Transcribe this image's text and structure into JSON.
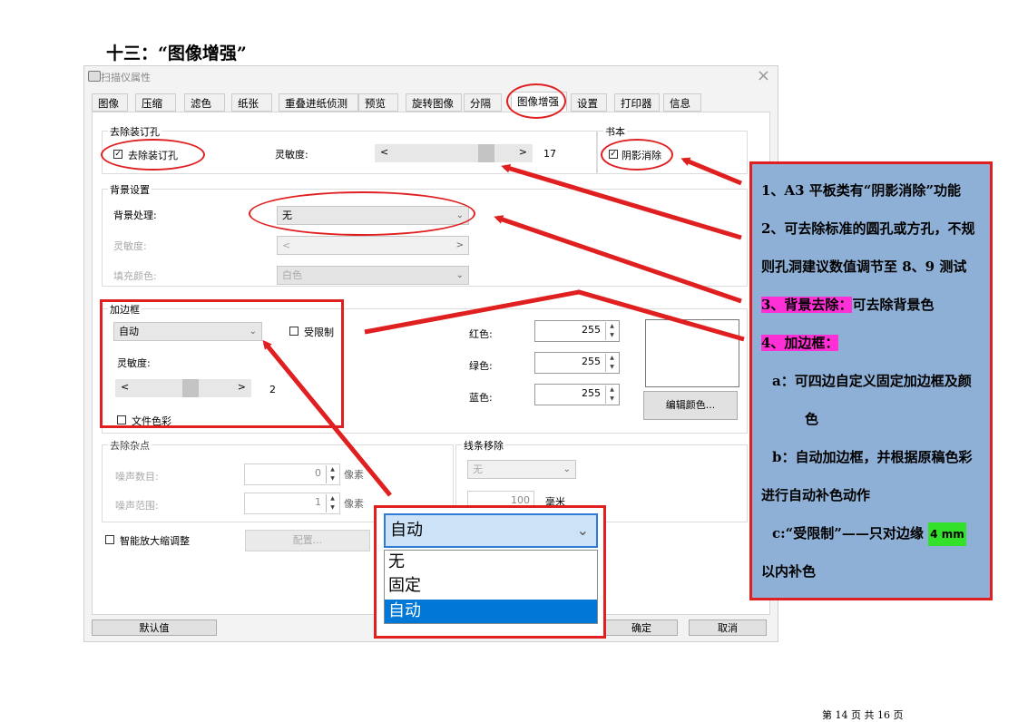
{
  "doc_title": "十三：“图像增强”",
  "dialog": {
    "title": "扫描仪属性",
    "close": "×",
    "tabs": [
      "图像",
      "压缩",
      "滤色",
      "纸张",
      "重叠进纸侦测",
      "预览",
      "旋转图像",
      "分隔",
      "图像增强",
      "设置",
      "打印器",
      "信息"
    ],
    "active_tab": "图像增强",
    "punch": {
      "group": "去除装订孔",
      "checkbox_label": "去除装订孔",
      "checked": true,
      "sens_label": "灵敏度:",
      "slider_value": "17"
    },
    "book": {
      "group": "书本",
      "checkbox_label": "阴影消除",
      "checked": true
    },
    "background": {
      "group": "背景设置",
      "process_label": "背景处理:",
      "process_value": "无",
      "sens_label": "灵敏度:",
      "fill_label": "填充颜色:",
      "fill_value": "白色"
    },
    "border": {
      "group": "加边框",
      "mode_value": "自动",
      "limit_label": "受限制",
      "sens_label": "灵敏度:",
      "slider_value": "2",
      "doc_color_label": "文件色彩",
      "red_label": "红色:",
      "red_value": "255",
      "green_label": "绿色:",
      "green_value": "255",
      "blue_label": "蓝色:",
      "blue_value": "255",
      "edit_color_button": "编辑颜色..."
    },
    "noise": {
      "group": "去除杂点",
      "count_label": "噪声数目:",
      "count_value": "0",
      "count_unit": "像素",
      "range_label": "噪声范围:",
      "range_value": "1",
      "range_unit": "像素"
    },
    "line_removal": {
      "group": "线条移除",
      "select_value": "无",
      "value": "100",
      "unit": "毫米"
    },
    "smart_zoom_label": "智能放大缩调整",
    "config_button": "配置...",
    "default_button": "默认值",
    "ok_button": "确定",
    "cancel_button": "取消"
  },
  "popup": {
    "selected": "自动",
    "options": [
      "无",
      "固定",
      "自动"
    ]
  },
  "callout": {
    "line1": "1、A3 平板类有“阴影消除”功能",
    "line2": "2、可去除标准的圆孔或方孔，不规",
    "line3": "则孔洞建议数值调节至 8、9 测试",
    "line4_hl": "3、背景去除：",
    "line4_rest": "可去除背景色",
    "line5_hl": "4、加边框：",
    "line6": "a：可四边自定义固定加边框及颜",
    "line7": "色",
    "line8": "b：自动加边框，并根据原稿色彩",
    "line9": "进行自动补色动作",
    "line10_pre": "c:“受限制”——只对边缘",
    "line10_hl": "4 mm",
    "line11": "以内补色"
  },
  "footer": "第 14 页 共 16 页",
  "colors": {
    "annotation_red": "#e02020",
    "callout_bg": "#8fb0d6",
    "highlight_pink": "#ff30d6",
    "highlight_green": "#33e02a",
    "selection_blue": "#0078d7"
  }
}
